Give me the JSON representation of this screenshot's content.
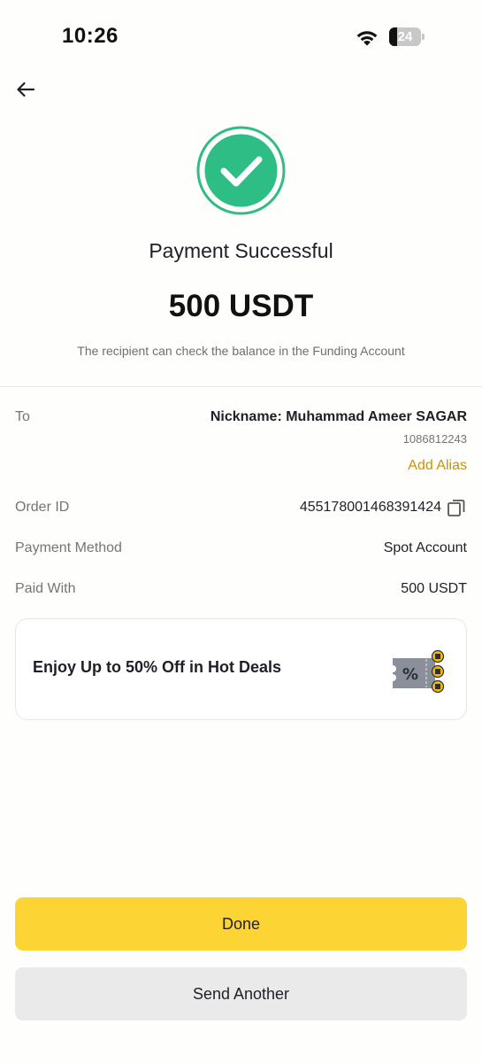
{
  "status_bar": {
    "time": "10:26",
    "battery": "24",
    "battery_level": 0.24,
    "wifi_icon": "wifi-icon"
  },
  "header": {
    "back_icon": "arrow-left-icon"
  },
  "result": {
    "icon": "check-circle-icon",
    "accent_color": "#2ebd85",
    "title": "Payment Successful",
    "amount": "500 USDT",
    "subtitle": "The recipient can check the balance in the Funding Account"
  },
  "details": {
    "to_label": "To",
    "to_nickname": "Nickname: Muhammad Ameer SAGAR",
    "to_id": "1086812243",
    "add_alias": "Add Alias",
    "order_id_label": "Order ID",
    "order_id_value": "455178001468391424",
    "copy_icon": "copy-icon",
    "payment_method_label": "Payment Method",
    "payment_method_value": "Spot Account",
    "paid_with_label": "Paid With",
    "paid_with_value": "500 USDT"
  },
  "promo": {
    "text": "Enjoy Up to 50% Off in Hot Deals",
    "icon": "coupon-icon"
  },
  "actions": {
    "done_label": "Done",
    "send_another_label": "Send Another",
    "primary_color": "#fcd535"
  }
}
